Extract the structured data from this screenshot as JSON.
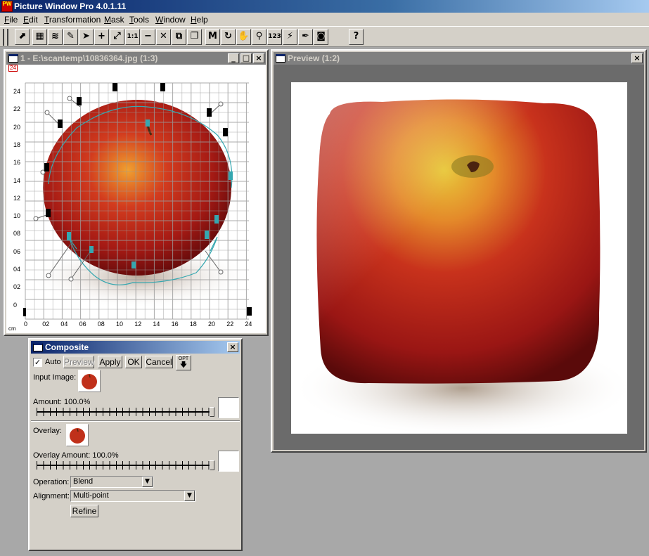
{
  "app": {
    "title": "Picture Window Pro 4.0.1.11",
    "icon_label": "PW"
  },
  "menu": [
    "File",
    "Edit",
    "Transformation",
    "Mask",
    "Tools",
    "Window",
    "Help"
  ],
  "toolbar": {
    "buttons": [
      "select-icon",
      "grid-icon",
      "wave-icon",
      "eyedropper-icon",
      "brush-icon",
      "zoom-in-icon",
      "fit-icon",
      "actual-size-icon",
      "zoom-out-icon",
      "shrink-icon",
      "cascade-icon",
      "copy-icon",
      "mask-icon",
      "arrow-circle-icon",
      "hand-icon",
      "magnifier-icon",
      "number-icon",
      "clone-icon",
      "retouch-icon",
      "camera-icon",
      "help-icon"
    ],
    "glyphs": [
      "⬈",
      "▦",
      "≋",
      "✎",
      "➤",
      "+",
      "⤢",
      "1:1",
      "−",
      "✕",
      "⧉",
      "❐",
      "M",
      "↻",
      "✋",
      "⚲",
      "123",
      "⚡",
      "✒",
      "◙",
      "?"
    ]
  },
  "source_window": {
    "title": "1 - E:\\scantemp\\10836364.jpg (1:3)",
    "corner_label": "24",
    "unit_label": "cm",
    "y_labels": [
      "24",
      "22",
      "20",
      "18",
      "16",
      "14",
      "12",
      "10",
      "08",
      "06",
      "04",
      "02",
      "0"
    ],
    "x_labels": [
      "0",
      "02",
      "04",
      "06",
      "08",
      "10",
      "12",
      "14",
      "16",
      "18",
      "20",
      "22",
      "24"
    ],
    "min_button": "_",
    "max_button": "□",
    "close_button": "×"
  },
  "preview_window": {
    "title": "Preview (1:2)",
    "close_button": "×"
  },
  "composite": {
    "title": "Composite",
    "close_button": "×",
    "auto_checked": true,
    "auto_label": "Auto",
    "preview_label": "Preview",
    "apply_label": "Apply",
    "ok_label": "OK",
    "cancel_label": "Cancel",
    "opt_label": "OPT",
    "input_image_label": "Input Image:",
    "amount_label": "Amount: 100.0%",
    "amount_value": 1.0,
    "overlay_label": "Overlay:",
    "overlay_amount_label": "Overlay Amount: 100.0%",
    "overlay_amount_value": 1.0,
    "operation_label": "Operation:",
    "operation_value": "Blend",
    "alignment_label": "Alignment:",
    "alignment_value": "Multi-point",
    "refine_label": "Refine"
  },
  "colors": {
    "title_active": "#0a246a",
    "title_inactive": "#808080",
    "face": "#d4d0c8",
    "workspace": "#a8a8a8",
    "control_point": "#3aa6b0"
  }
}
